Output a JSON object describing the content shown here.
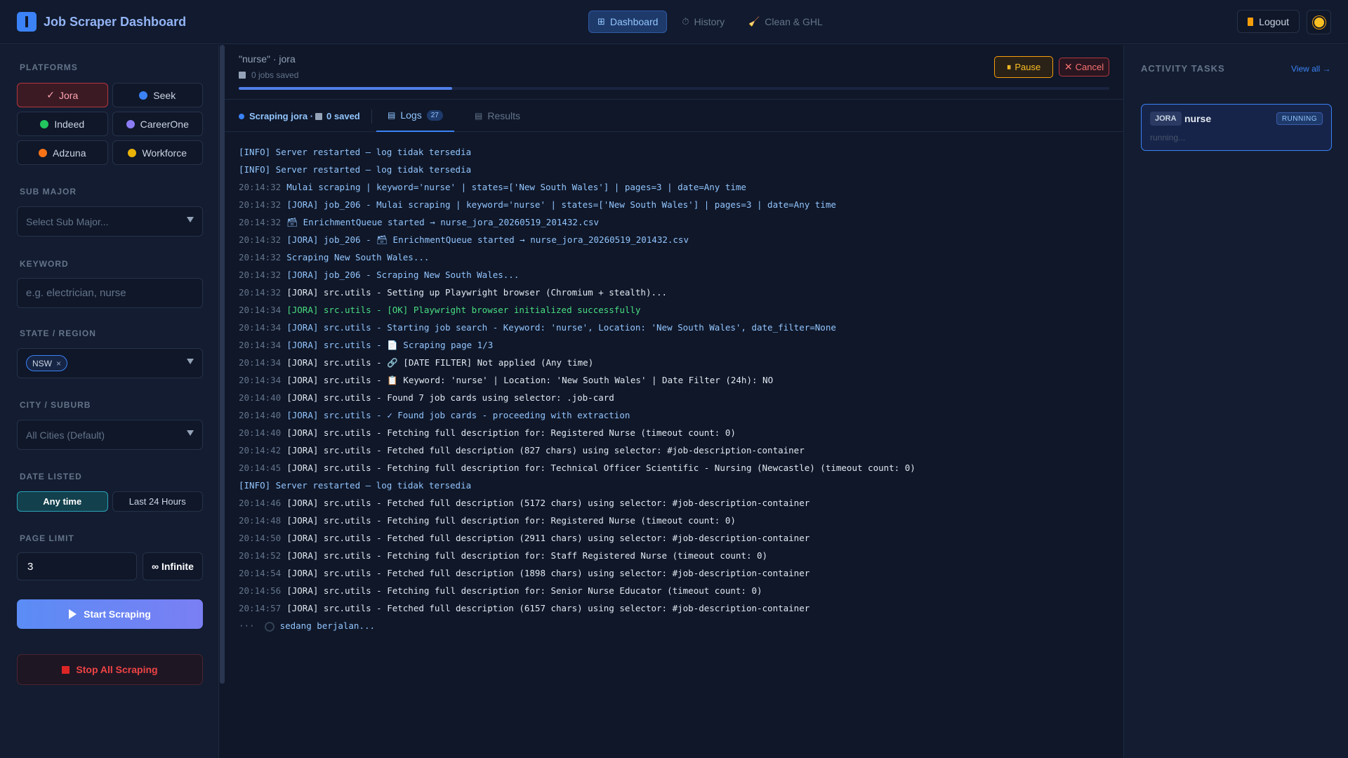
{
  "header": {
    "title": "Job Scraper Dashboard",
    "nav": [
      {
        "label": "Dashboard",
        "icon": "grid-icon"
      },
      {
        "label": "History",
        "icon": "clock-icon"
      },
      {
        "label": "Clean & GHL",
        "icon": "broom-icon"
      }
    ],
    "logout_label": "Logout"
  },
  "sidebar": {
    "platforms_label": "PLATFORMS",
    "platforms": [
      {
        "label": "Jora",
        "selected": true,
        "color": "#ef4444"
      },
      {
        "label": "Seek",
        "selected": false,
        "color": "#3b82f6"
      },
      {
        "label": "Indeed",
        "selected": false,
        "color": "#22c55e"
      },
      {
        "label": "CareerOne",
        "selected": false,
        "color": "#8b7cf6"
      },
      {
        "label": "Adzuna",
        "selected": false,
        "color": "#f97316"
      },
      {
        "label": "Workforce",
        "selected": false,
        "color": "#eab308"
      }
    ],
    "sub_major_label": "SUB MAJOR",
    "sub_major_placeholder": "Select Sub Major...",
    "keyword_label": "KEYWORD",
    "keyword_placeholder": "e.g. electrician, nurse",
    "state_label": "STATE / REGION",
    "state_chip": "NSW",
    "city_label": "CITY / SUBURB",
    "city_value": "All Cities (Default)",
    "date_label": "DATE LISTED",
    "date_options": [
      "Any time",
      "Last 24 Hours"
    ],
    "date_selected": "Any time",
    "page_limit_label": "PAGE LIMIT",
    "page_limit_value": "3",
    "infinite_label": "∞ Infinite",
    "start_label": "Start Scraping",
    "stop_label": "Stop All Scraping"
  },
  "main": {
    "job_title": "\"nurse\" · jora",
    "jobs_saved": "0 jobs saved",
    "progress": 0.245,
    "pause_label": "Pause",
    "cancel_label": "Cancel",
    "status_text": "Scraping jora · ",
    "status_saved": "0 saved",
    "tabs": [
      {
        "label": "Logs",
        "badge": "27",
        "active": true
      },
      {
        "label": "Results",
        "active": false
      }
    ],
    "logs": [
      {
        "time": "",
        "msg": "[INFO] Server restarted — log tidak tersedia",
        "type": "info"
      },
      {
        "time": "",
        "msg": "[INFO] Server restarted — log tidak tersedia",
        "type": "info"
      },
      {
        "time": "20:14:32",
        "msg": "Mulai scraping | keyword='nurse' | states=['New South Wales'] | pages=3 | date=Any time",
        "type": "blue"
      },
      {
        "time": "20:14:32",
        "msg": "[JORA] job_206 - Mulai scraping | keyword='nurse' | states=['New South Wales'] | pages=3 | date=Any time",
        "type": "blue"
      },
      {
        "time": "20:14:32",
        "msg": "🗃 EnrichmentQueue started → nurse_jora_20260519_201432.csv",
        "type": "blue"
      },
      {
        "time": "20:14:32",
        "msg": "[JORA] job_206 - 🗃 EnrichmentQueue started → nurse_jora_20260519_201432.csv",
        "type": "blue"
      },
      {
        "time": "20:14:32",
        "msg": "Scraping New South Wales...",
        "type": "blue"
      },
      {
        "time": "20:14:32",
        "msg": "[JORA] job_206 - Scraping New South Wales...",
        "type": "blue"
      },
      {
        "time": "20:14:32",
        "msg": "[JORA] src.utils - Setting up Playwright browser (Chromium + stealth)...",
        "type": "plain"
      },
      {
        "time": "20:14:34",
        "msg": "[JORA] src.utils - [OK] Playwright browser initialized successfully",
        "type": "green"
      },
      {
        "time": "20:14:34",
        "msg": "[JORA] src.utils - Starting job search - Keyword: 'nurse', Location: 'New South Wales', date_filter=None",
        "type": "blue"
      },
      {
        "time": "20:14:34",
        "msg": "[JORA] src.utils - 📄 Scraping page 1/3",
        "type": "blue"
      },
      {
        "time": "20:14:34",
        "msg": "[JORA] src.utils - 🔗 [DATE FILTER] Not applied (Any time)",
        "type": "plain"
      },
      {
        "time": "20:14:34",
        "msg": "[JORA] src.utils - 📋 Keyword: 'nurse' | Location: 'New South Wales' | Date Filter (24h): NO",
        "type": "plain"
      },
      {
        "time": "20:14:40",
        "msg": "[JORA] src.utils - Found 7 job cards using selector: .job-card",
        "type": "plain"
      },
      {
        "time": "20:14:40",
        "msg": "[JORA] src.utils - ✓ Found job cards - proceeding with extraction",
        "type": "blue"
      },
      {
        "time": "20:14:40",
        "msg": "[JORA] src.utils - Fetching full description for: Registered Nurse (timeout count: 0)",
        "type": "plain"
      },
      {
        "time": "20:14:42",
        "msg": "[JORA] src.utils - Fetched full description (827 chars) using selector: #job-description-container",
        "type": "plain"
      },
      {
        "time": "20:14:45",
        "msg": "[JORA] src.utils - Fetching full description for: Technical Officer Scientific - Nursing (Newcastle) (timeout count: 0)",
        "type": "plain"
      },
      {
        "time": "",
        "msg": "[INFO] Server restarted — log tidak tersedia",
        "type": "info"
      },
      {
        "time": "20:14:46",
        "msg": "[JORA] src.utils - Fetched full description (5172 chars) using selector: #job-description-container",
        "type": "plain"
      },
      {
        "time": "20:14:48",
        "msg": "[JORA] src.utils - Fetching full description for: Registered Nurse (timeout count: 0)",
        "type": "plain"
      },
      {
        "time": "20:14:50",
        "msg": "[JORA] src.utils - Fetched full description (2911 chars) using selector: #job-description-container",
        "type": "plain"
      },
      {
        "time": "20:14:52",
        "msg": "[JORA] src.utils - Fetching full description for: Staff Registered Nurse (timeout count: 0)",
        "type": "plain"
      },
      {
        "time": "20:14:54",
        "msg": "[JORA] src.utils - Fetched full description (1898 chars) using selector: #job-description-container",
        "type": "plain"
      },
      {
        "time": "20:14:56",
        "msg": "[JORA] src.utils - Fetching full description for: Senior Nurse Educator (timeout count: 0)",
        "type": "plain"
      },
      {
        "time": "20:14:57",
        "msg": "[JORA] src.utils - Fetched full description (6157 chars) using selector: #job-description-container",
        "type": "plain"
      }
    ],
    "running_prefix": "···",
    "running_text": "sedang berjalan..."
  },
  "activity": {
    "title": "ACTIVITY TASKS",
    "view_all": "View all →",
    "tasks": [
      {
        "source": "JORA",
        "keyword": "nurse",
        "status": "RUNNING",
        "sub": "running..."
      }
    ]
  }
}
